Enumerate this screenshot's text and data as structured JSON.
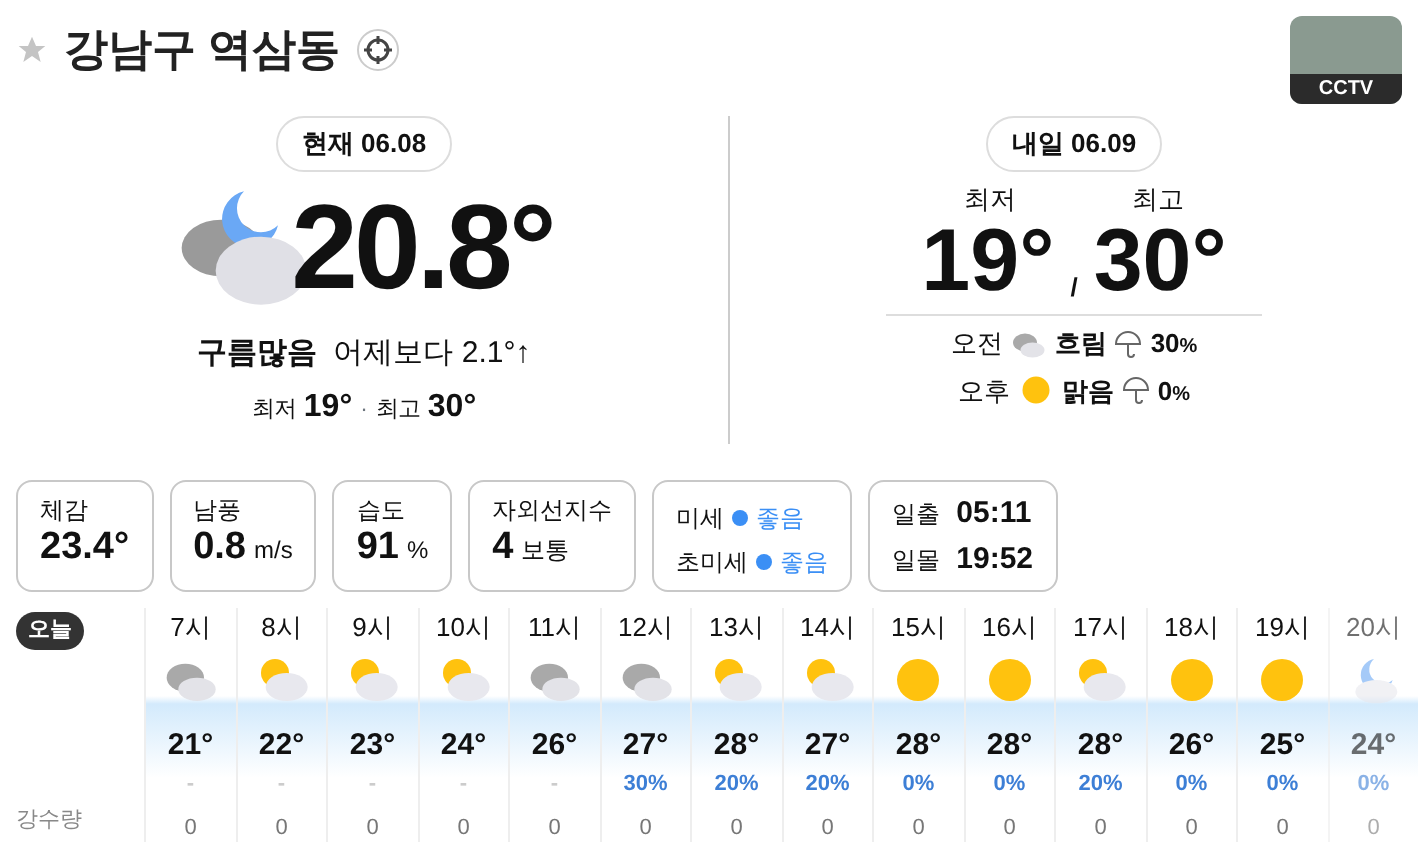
{
  "location": {
    "title": "강남구 역삼동",
    "favorite": false
  },
  "cctv": {
    "label": "CCTV"
  },
  "today": {
    "date_badge": "현재 06.08",
    "temperature": "20.8°",
    "condition": "구름많음",
    "compare": "어제보다 2.1°↑",
    "low_label": "최저",
    "low": "19°",
    "separator": "·",
    "high_label": "최고",
    "high": "30°"
  },
  "tomorrow": {
    "date_badge": "내일 06.09",
    "low_label": "최저",
    "high_label": "최고",
    "low": "19°",
    "slash": "/",
    "high": "30°",
    "periods": [
      {
        "label": "오전",
        "kind": "cloudy",
        "condition": "흐림",
        "rain": "30",
        "unit": "%"
      },
      {
        "label": "오후",
        "kind": "sunny",
        "condition": "맑음",
        "rain": "0",
        "unit": "%"
      }
    ]
  },
  "cards": [
    {
      "kind": "value",
      "label": "체감",
      "value": "23.4°"
    },
    {
      "kind": "value",
      "label": "남풍",
      "value": "0.8",
      "unit": "m/s"
    },
    {
      "kind": "value",
      "label": "습도",
      "value": "91",
      "unit": "%"
    },
    {
      "kind": "value",
      "label": "자외선지수",
      "value": "4",
      "unit": "보통"
    },
    {
      "kind": "dust",
      "rows": [
        {
          "label": "미세",
          "status": "좋음",
          "color": "#3b8ff5"
        },
        {
          "label": "초미세",
          "status": "좋음",
          "color": "#3b8ff5"
        }
      ]
    },
    {
      "kind": "sun",
      "rows": [
        {
          "label": "일출",
          "time": "05:11"
        },
        {
          "label": "일몰",
          "time": "19:52"
        }
      ]
    }
  ],
  "hourly": {
    "day_badge": "오늘",
    "rain_label": "강수량",
    "hours": [
      {
        "time": "7시",
        "kind": "cloudy",
        "temp": "21°",
        "chance": "-",
        "muted": true,
        "rain": "0",
        "faded": false
      },
      {
        "time": "8시",
        "kind": "partly",
        "temp": "22°",
        "chance": "-",
        "muted": true,
        "rain": "0",
        "faded": false
      },
      {
        "time": "9시",
        "kind": "partly",
        "temp": "23°",
        "chance": "-",
        "muted": true,
        "rain": "0",
        "faded": false
      },
      {
        "time": "10시",
        "kind": "partly",
        "temp": "24°",
        "chance": "-",
        "muted": true,
        "rain": "0",
        "faded": false
      },
      {
        "time": "11시",
        "kind": "cloudy",
        "temp": "26°",
        "chance": "-",
        "muted": true,
        "rain": "0",
        "faded": false
      },
      {
        "time": "12시",
        "kind": "cloudy",
        "temp": "27°",
        "chance": "30%",
        "muted": false,
        "rain": "0",
        "faded": false
      },
      {
        "time": "13시",
        "kind": "partly",
        "temp": "28°",
        "chance": "20%",
        "muted": false,
        "rain": "0",
        "faded": false
      },
      {
        "time": "14시",
        "kind": "partly",
        "temp": "27°",
        "chance": "20%",
        "muted": false,
        "rain": "0",
        "faded": false
      },
      {
        "time": "15시",
        "kind": "sunny",
        "temp": "28°",
        "chance": "0%",
        "muted": false,
        "rain": "0",
        "faded": false
      },
      {
        "time": "16시",
        "kind": "sunny",
        "temp": "28°",
        "chance": "0%",
        "muted": false,
        "rain": "0",
        "faded": false
      },
      {
        "time": "17시",
        "kind": "partly",
        "temp": "28°",
        "chance": "20%",
        "muted": false,
        "rain": "0",
        "faded": false
      },
      {
        "time": "18시",
        "kind": "sunny",
        "temp": "26°",
        "chance": "0%",
        "muted": false,
        "rain": "0",
        "faded": false
      },
      {
        "time": "19시",
        "kind": "sunny",
        "temp": "25°",
        "chance": "0%",
        "muted": false,
        "rain": "0",
        "faded": false
      },
      {
        "time": "20시",
        "kind": "night",
        "temp": "24°",
        "chance": "0%",
        "muted": false,
        "rain": "0",
        "faded": true
      }
    ]
  }
}
